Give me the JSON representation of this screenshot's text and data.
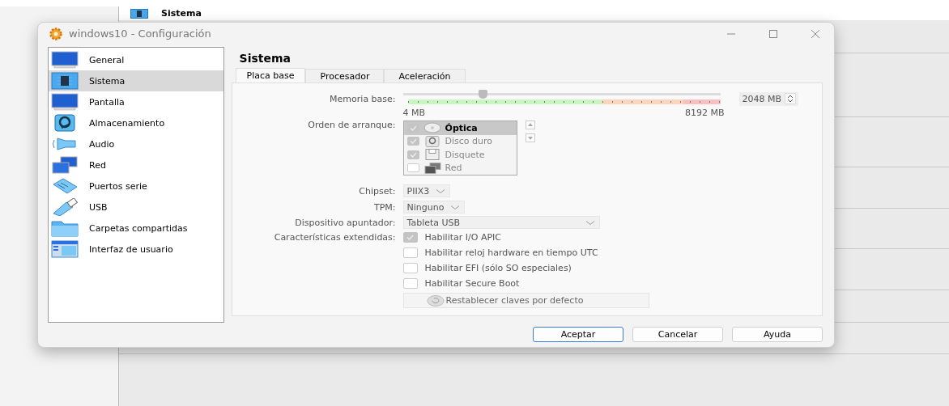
{
  "background": {
    "section_title": "Sistema"
  },
  "window": {
    "title": "windows10 - Configuración"
  },
  "sidebar": {
    "items": [
      {
        "label": "General",
        "selected": false
      },
      {
        "label": "Sistema",
        "selected": true
      },
      {
        "label": "Pantalla",
        "selected": false
      },
      {
        "label": "Almacenamiento",
        "selected": false
      },
      {
        "label": "Audio",
        "selected": false
      },
      {
        "label": "Red",
        "selected": false
      },
      {
        "label": "Puertos serie",
        "selected": false
      },
      {
        "label": "USB",
        "selected": false
      },
      {
        "label": "Carpetas compartidas",
        "selected": false
      },
      {
        "label": "Interfaz de usuario",
        "selected": false
      }
    ]
  },
  "page_title": "Sistema",
  "tabs": [
    {
      "label": "Placa base",
      "selected": true
    },
    {
      "label": "Procesador",
      "selected": false
    },
    {
      "label": "Aceleración",
      "selected": false
    }
  ],
  "memory": {
    "label": "Memoria base:",
    "level": 0.25,
    "min_label": "4 MB",
    "max_label": "8192 MB",
    "value": "2048 MB"
  },
  "boot_order": {
    "label": "Orden de arranque:",
    "items": [
      {
        "label": "Óptica",
        "checked": true,
        "selected": true
      },
      {
        "label": "Disco duro",
        "checked": true,
        "selected": false
      },
      {
        "label": "Disquete",
        "checked": true,
        "selected": false
      },
      {
        "label": "Red",
        "checked": false,
        "selected": false
      }
    ]
  },
  "chipset": {
    "label": "Chipset:",
    "value": "PIIX3"
  },
  "tpm": {
    "label": "TPM:",
    "value": "Ninguno"
  },
  "pointing_device": {
    "label": "Dispositivo apuntador:",
    "value": "Tableta USB"
  },
  "extended_features": {
    "label": "Características extendidas:",
    "options": [
      {
        "label": "Habilitar I/O APIC",
        "checked": true
      },
      {
        "label": "Habilitar reloj hardware en tiempo UTC",
        "checked": false
      },
      {
        "label": "Habilitar EFI (sólo SO especiales)",
        "checked": false
      },
      {
        "label": "Habilitar Secure Boot",
        "checked": false
      }
    ]
  },
  "reset_keys_button": "Restablecer claves por defecto",
  "buttons": [
    {
      "label": "Aceptar",
      "focused": true
    },
    {
      "label": "Cancelar",
      "focused": false
    },
    {
      "label": "Ayuda",
      "focused": false
    }
  ]
}
